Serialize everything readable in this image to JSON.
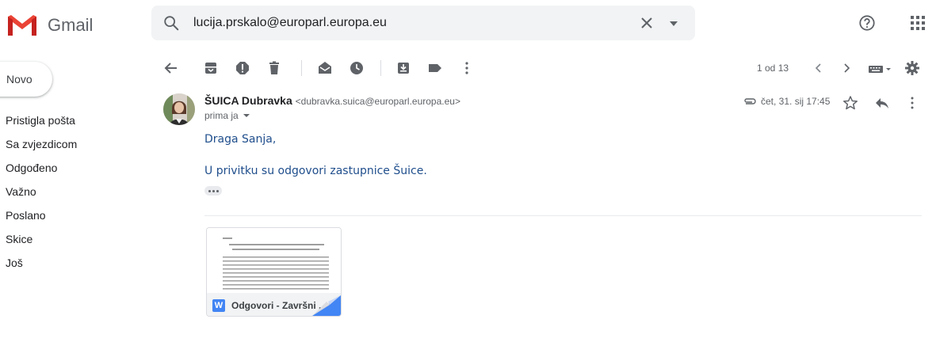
{
  "app": {
    "name": "Gmail"
  },
  "search": {
    "value": "lucija.prskalo@europarl.europa.eu"
  },
  "sidebar": {
    "compose_label": "Novo",
    "items": [
      {
        "label": "Pristigla pošta"
      },
      {
        "label": "Sa zvjezdicom"
      },
      {
        "label": "Odgođeno"
      },
      {
        "label": "Važno"
      },
      {
        "label": "Poslano"
      },
      {
        "label": "Skice"
      },
      {
        "label": "Još"
      }
    ]
  },
  "toolbar": {
    "pager": "1 od 13",
    "icons": [
      "back-arrow-icon",
      "archive-icon",
      "report-spam-icon",
      "delete-icon",
      "mark-unread-icon",
      "snooze-icon",
      "move-to-icon",
      "label-icon",
      "more-vert-icon",
      "newer-icon",
      "older-icon",
      "keyboard-icon",
      "settings-icon"
    ]
  },
  "message": {
    "sender_name": "ŠUICA Dubravka",
    "sender_email": "<dubravka.suica@europarl.europa.eu>",
    "recipient": "prima ja",
    "date": "čet, 31. sij 17:45",
    "greeting": "Draga Sanja,",
    "body": "U privitku su odgovori zastupnice Šuice.",
    "attachment": {
      "name": "Odgovori - Završni ...",
      "type_badge": "W"
    }
  },
  "colors": {
    "gmail_red": "#ea4335",
    "link_blue": "#1f4e8c",
    "word_blue": "#4285f4"
  }
}
